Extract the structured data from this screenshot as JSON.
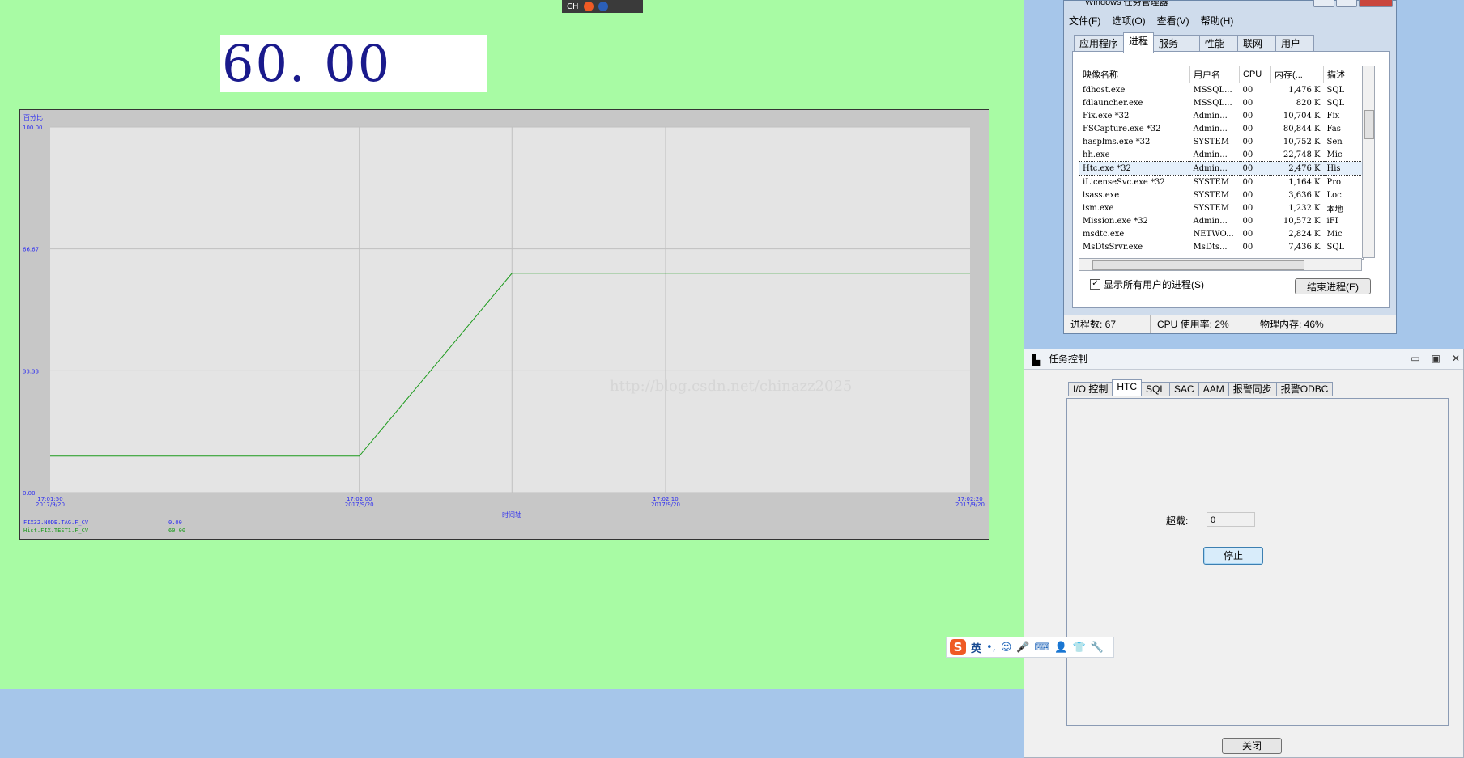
{
  "top_toolbar": {
    "label": "CH"
  },
  "display": {
    "value": "60. 00"
  },
  "trend": {
    "axis_unit_label": "百分比",
    "x_axis_title": "时间轴",
    "y_ticks": [
      "100.00",
      "66.67",
      "33.33",
      "0.00"
    ],
    "x_tick_times": [
      "17:01:50",
      "17:02:00",
      "17:02:10",
      "17:02:20"
    ],
    "x_tick_dates": [
      "2017/9/20",
      "2017/9/20",
      "2017/9/20",
      "2017/9/20"
    ],
    "legend": [
      {
        "tag": "FIX32.NODE.TAG.F_CV",
        "value": "0.00",
        "color": "#2e2ef0"
      },
      {
        "tag": "Hist.FIX.TEST1.F_CV",
        "value": "60.00",
        "color": "#1b9a1b"
      }
    ],
    "watermark": "http://blog.csdn.net/chinazz2025"
  },
  "chart_data": {
    "type": "line",
    "ylim": [
      0,
      100
    ],
    "series": [
      {
        "name": "Hist.FIX.TEST1.F_CV",
        "x": [
          0,
          0.336,
          0.502,
          1.0
        ],
        "values": [
          10,
          10,
          60,
          60
        ]
      }
    ],
    "y_ticks": [
      0,
      33.33,
      66.67,
      100
    ],
    "grid": true
  },
  "taskmgr": {
    "title": "Windows 任务管理器",
    "menu": [
      "文件(F)",
      "选项(O)",
      "查看(V)",
      "帮助(H)"
    ],
    "tabs": [
      "应用程序",
      "进程",
      "服务",
      "性能",
      "联网",
      "用户"
    ],
    "active_tab": 1,
    "columns": [
      "映像名称",
      "用户名",
      "CPU",
      "内存(...",
      "描述"
    ],
    "rows": [
      [
        "fdhost.exe",
        "MSSQL...",
        "00",
        "1,476 K",
        "SQL"
      ],
      [
        "fdlauncher.exe",
        "MSSQL...",
        "00",
        "820 K",
        "SQL"
      ],
      [
        "Fix.exe *32",
        "Admin...",
        "00",
        "10,704 K",
        "Fix"
      ],
      [
        "FSCapture.exe *32",
        "Admin...",
        "00",
        "80,844 K",
        "Fas"
      ],
      [
        "hasplms.exe *32",
        "SYSTEM",
        "00",
        "10,752 K",
        "Sen"
      ],
      [
        "hh.exe",
        "Admin...",
        "00",
        "22,748 K",
        "Mic"
      ],
      [
        "Htc.exe *32",
        "Admin...",
        "00",
        "2,476 K",
        "His"
      ],
      [
        "iLicenseSvc.exe *32",
        "SYSTEM",
        "00",
        "1,164 K",
        "Pro"
      ],
      [
        "lsass.exe",
        "SYSTEM",
        "00",
        "3,636 K",
        "Loc"
      ],
      [
        "lsm.exe",
        "SYSTEM",
        "00",
        "1,232 K",
        "本地"
      ],
      [
        "Mission.exe *32",
        "Admin...",
        "00",
        "10,572 K",
        "iFI"
      ],
      [
        "msdtc.exe",
        "NETWO...",
        "00",
        "2,824 K",
        "Mic"
      ],
      [
        "MsDtsSrvr.exe",
        "MsDts...",
        "00",
        "7,436 K",
        "SQL"
      ]
    ],
    "selected_row": 6,
    "show_all_label": "显示所有用户的进程(S)",
    "end_process_label": "结束进程(E)",
    "status": {
      "processes": "进程数: 67",
      "cpu": "CPU 使用率: 2%",
      "memory": "物理内存: 46%"
    }
  },
  "taskctl": {
    "title": "任务控制",
    "tabs": [
      "I/O 控制",
      "HTC",
      "SQL",
      "SAC",
      "AAM",
      "报警同步",
      "报警ODBC"
    ],
    "active_tab": 1,
    "timeout_label": "超载:",
    "timeout_value": "0",
    "stop_label": "停止",
    "close_label": "关闭"
  },
  "ime": {
    "mode": "英"
  }
}
